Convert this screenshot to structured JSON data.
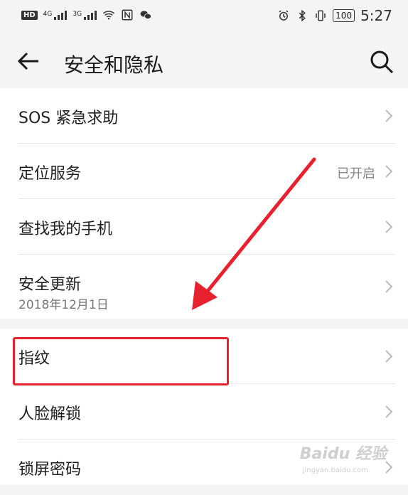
{
  "status_bar": {
    "hd": "HD",
    "net1": "4G",
    "net2": "3G",
    "battery": "100",
    "time": "5:27",
    "icons": [
      "wifi-icon",
      "nfc-icon",
      "wechat-icon",
      "alarm-icon",
      "bluetooth-icon",
      "vibrate-icon"
    ]
  },
  "header": {
    "title": "安全和隐私",
    "back_icon": "back-arrow-icon",
    "search_icon": "search-icon"
  },
  "list1": [
    {
      "label": "SOS 紧急求助",
      "value": "",
      "sub": ""
    },
    {
      "label": "定位服务",
      "value": "已开启",
      "sub": ""
    },
    {
      "label": "查找我的手机",
      "value": "",
      "sub": ""
    },
    {
      "label": "安全更新",
      "value": "",
      "sub": "2018年12月1日"
    }
  ],
  "list2": [
    {
      "label": "指纹",
      "highlighted": true
    },
    {
      "label": "人脸解锁"
    },
    {
      "label": "锁屏密码"
    }
  ],
  "annotation": {
    "color": "#e8212f"
  },
  "watermark": {
    "brand": "Baidu 经验",
    "url": "jingyan.baidu.com"
  }
}
